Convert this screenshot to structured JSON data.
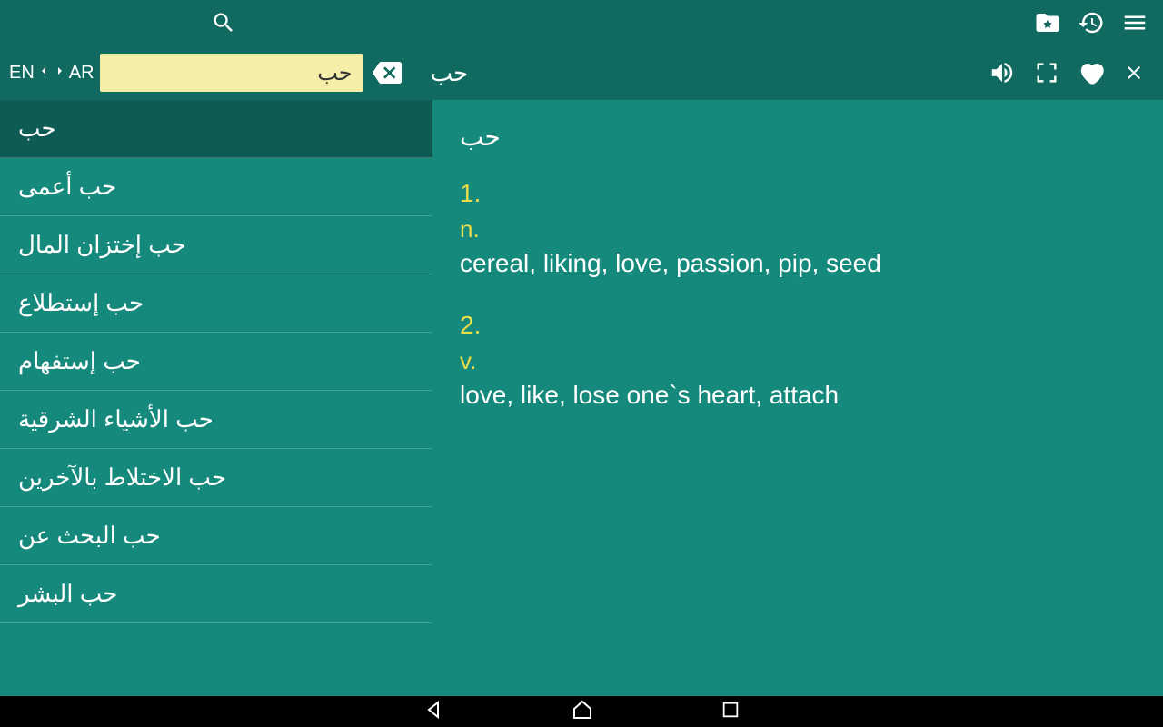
{
  "langSwitch": {
    "from": "EN",
    "to": "AR"
  },
  "searchValue": "حب",
  "headerWord": "حب",
  "sidebar": {
    "items": [
      {
        "label": "حب",
        "selected": true
      },
      {
        "label": "حب أعمى"
      },
      {
        "label": "حب إختزان المال"
      },
      {
        "label": "حب إستطلاع"
      },
      {
        "label": "حب إستفهام"
      },
      {
        "label": "حب الأشياء الشرقية"
      },
      {
        "label": "حب الاختلاط بالآخرين"
      },
      {
        "label": "حب البحث عن"
      },
      {
        "label": "حب البشر"
      }
    ]
  },
  "detail": {
    "word": "حب",
    "senses": [
      {
        "num": "1.",
        "pos": "n.",
        "translation": "cereal, liking, love, passion, pip, seed"
      },
      {
        "num": "2.",
        "pos": "v.",
        "translation": "love, like, lose one`s heart, attach"
      }
    ]
  }
}
